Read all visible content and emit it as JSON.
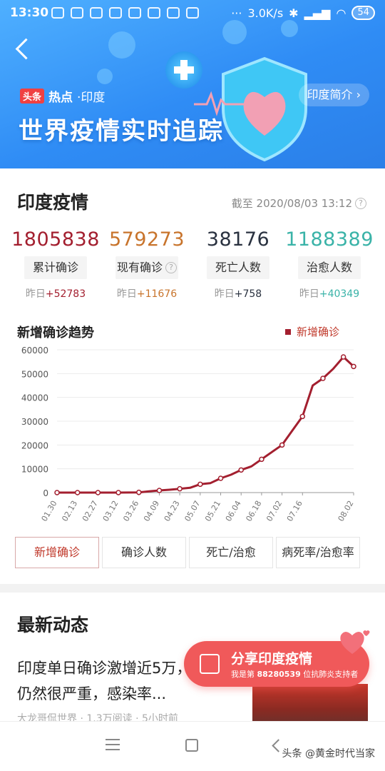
{
  "status_bar": {
    "time": "13:30",
    "net_speed": "3.0K/s",
    "battery": "54"
  },
  "header": {
    "source_tag": "头条",
    "section_tag": "热点",
    "region_tag": "·印度",
    "title": "世界疫情实时追踪",
    "intro_button": "印度简介 ›"
  },
  "overview": {
    "title": "印度疫情",
    "as_of": "截至 2020/08/03 13:12",
    "stats": [
      {
        "value": "1805838",
        "label": "累计确诊",
        "delta_prefix": "昨日",
        "delta": "+52783",
        "color": "#a31f2f"
      },
      {
        "value": "579273",
        "label": "现有确诊",
        "delta_prefix": "昨日",
        "delta": "+11676",
        "color": "#c8742c"
      },
      {
        "value": "38176",
        "label": "死亡人数",
        "delta_prefix": "昨日",
        "delta": "+758",
        "color": "#2a3240"
      },
      {
        "value": "1188389",
        "label": "治愈人数",
        "delta_prefix": "昨日",
        "delta": "+40349",
        "color": "#3ab3a8"
      }
    ]
  },
  "trend": {
    "title": "新增确诊趋势",
    "legend": "新增确诊"
  },
  "chart_data": {
    "type": "line",
    "title": "新增确诊趋势",
    "series": [
      {
        "name": "新增确诊",
        "color": "#a31f2f",
        "x": [
          "01.30",
          "02.06",
          "02.13",
          "02.20",
          "02.27",
          "03.05",
          "03.12",
          "03.19",
          "03.26",
          "04.02",
          "04.09",
          "04.16",
          "04.23",
          "04.30",
          "05.07",
          "05.14",
          "05.21",
          "05.28",
          "06.04",
          "06.11",
          "06.18",
          "06.25",
          "07.02",
          "07.09",
          "07.16",
          "07.23",
          "07.27",
          "07.30",
          "08.01",
          "08.02"
        ],
        "values": [
          0,
          0,
          0,
          0,
          0,
          0,
          10,
          30,
          100,
          500,
          900,
          1200,
          1600,
          2000,
          3500,
          4000,
          6000,
          7500,
          9500,
          11000,
          14000,
          17000,
          20000,
          26000,
          32000,
          45000,
          48000,
          52000,
          57000,
          53000
        ]
      }
    ],
    "xtick_labels": [
      "01.30",
      "02.13",
      "02.27",
      "03.12",
      "03.26",
      "04.09",
      "04.23",
      "05.07",
      "05.21",
      "06.04",
      "06.18",
      "07.02",
      "07.16",
      "08.02"
    ],
    "yticks": [
      0,
      10000,
      20000,
      30000,
      40000,
      50000,
      60000
    ],
    "ylim": [
      0,
      60000
    ],
    "grid": "horizontal",
    "legend_position": "top-right"
  },
  "tabs": [
    "新增确诊",
    "确诊人数",
    "死亡/治愈",
    "病死率/治愈率"
  ],
  "news": {
    "title": "最新动态",
    "headline": "印度单日确诊激增近5万，疫情仍然很严重，感染率...",
    "meta": "大龙哥侃世界 · 1.3万阅读 · 5小时前"
  },
  "share": {
    "label": "分享印度疫情",
    "sub_prefix": "我是第",
    "sub_number": "88280539",
    "sub_suffix": "位抗肺炎支持者"
  },
  "watermark": "头条 @黄金时代当家"
}
